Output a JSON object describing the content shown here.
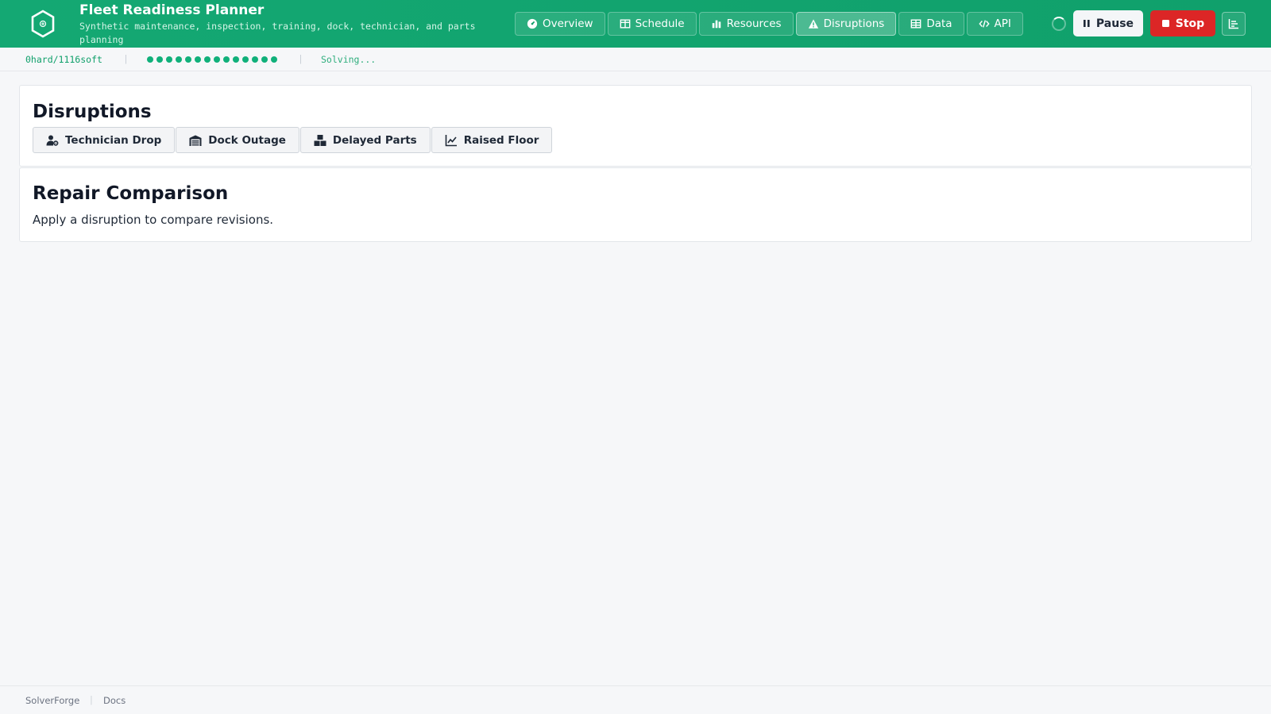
{
  "header": {
    "title": "Fleet Readiness Planner",
    "subtitle": "Synthetic maintenance, inspection, training, dock, technician, and parts planning",
    "tabs": [
      {
        "label": "Overview",
        "icon": "dashboard-icon"
      },
      {
        "label": "Schedule",
        "icon": "columns-icon"
      },
      {
        "label": "Resources",
        "icon": "bar-chart-icon"
      },
      {
        "label": "Disruptions",
        "icon": "warning-icon"
      },
      {
        "label": "Data",
        "icon": "table-icon"
      },
      {
        "label": "API",
        "icon": "code-icon"
      }
    ],
    "active_tab": "Disruptions",
    "pause_label": "Pause",
    "stop_label": "Stop"
  },
  "status": {
    "score": "0hard/1116soft",
    "progress_dots": 14,
    "state": "Solving..."
  },
  "disruptions": {
    "title": "Disruptions",
    "buttons": [
      {
        "label": "Technician Drop",
        "icon": "user-cog-icon"
      },
      {
        "label": "Dock Outage",
        "icon": "warehouse-icon"
      },
      {
        "label": "Delayed Parts",
        "icon": "boxes-icon"
      },
      {
        "label": "Raised Floor",
        "icon": "line-chart-icon"
      }
    ]
  },
  "repair": {
    "title": "Repair Comparison",
    "message": "Apply a disruption to compare revisions."
  },
  "footer": {
    "brand": "SolverForge",
    "docs": "Docs"
  },
  "colors": {
    "header_green": "#10a06b",
    "stop_red": "#dc2626",
    "status_green": "#10b07a"
  }
}
